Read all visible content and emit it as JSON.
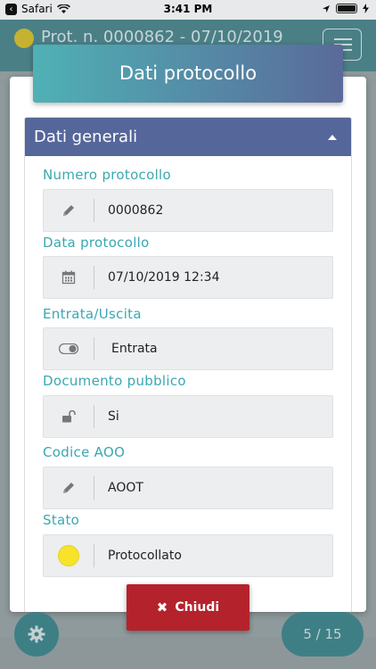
{
  "status_bar": {
    "back_label": "Safari",
    "time": "3:41 PM"
  },
  "app_bar": {
    "title": "Prot. n. 0000862 - 07/10/2019"
  },
  "modal": {
    "title": "Dati protocollo",
    "section_title": "Dati generali",
    "fields": [
      {
        "label": "Numero protocollo",
        "value": "0000862",
        "icon": "pencil-icon"
      },
      {
        "label": "Data protocollo",
        "value": "07/10/2019 12:34",
        "icon": "calendar-icon"
      },
      {
        "label": "Entrata/Uscita",
        "value": "Entrata",
        "icon": "toggle-icon"
      },
      {
        "label": "Documento pubblico",
        "value": "Si",
        "icon": "unlock-icon"
      },
      {
        "label": "Codice AOO",
        "value": "AOOT",
        "icon": "pencil-icon"
      },
      {
        "label": "Stato",
        "value": "Protocollato",
        "icon": "yellow-dot-icon"
      }
    ]
  },
  "close_button": {
    "label": "Chiudi"
  },
  "pager": {
    "label": "5 / 15"
  },
  "colors": {
    "accent": "#3aa8b0",
    "section_header": "#55669a",
    "close": "#b4232c",
    "state": "#f7e32a"
  }
}
